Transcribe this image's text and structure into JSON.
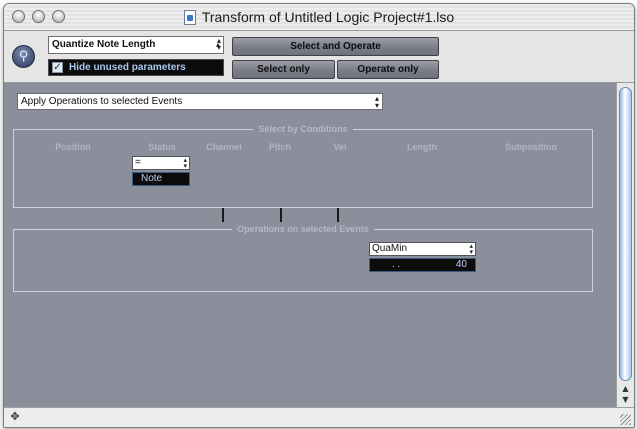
{
  "window": {
    "title": "Transform of Untitled Logic Project#1.lso"
  },
  "toolbar": {
    "preset": "Quantize Note Length",
    "hide_unused_label": "Hide unused parameters",
    "hide_unused_checked": "✓",
    "select_and_operate": "Select and Operate",
    "select_only": "Select only",
    "operate_only": "Operate only"
  },
  "main": {
    "apply_mode": "Apply Operations to selected Events",
    "conditions": {
      "title": "Select by Conditions",
      "columns": [
        "Position",
        "Status",
        "Channel",
        "Pitch",
        "Vel",
        "Length",
        "Subposition"
      ],
      "status_operator": "=",
      "status_value": "Note"
    },
    "operations": {
      "title": "Operations on selected Events",
      "length_operation": "QuaMin",
      "length_value_dots": ".     .",
      "length_value": "40"
    }
  },
  "colors": {
    "panel_bg": "#8b8f9c",
    "button_bg": "#7c7f89",
    "field_dark": "#0b0b0b",
    "field_text": "#b8d0f0"
  }
}
